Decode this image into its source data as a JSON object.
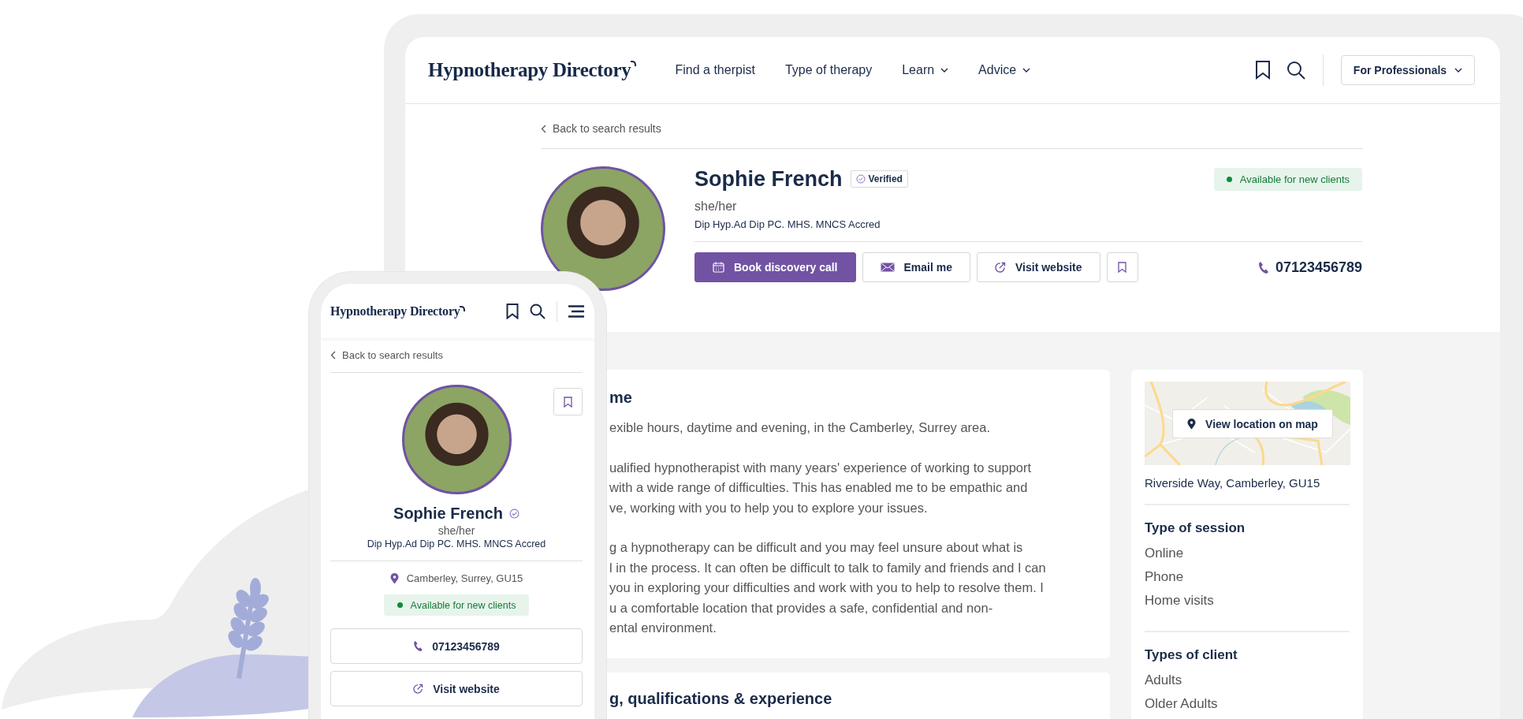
{
  "tablet": {
    "header": {
      "logo": "Hypnotherapy Directory",
      "nav": [
        {
          "label": "Find a therpist",
          "dropdown": false
        },
        {
          "label": "Type of therapy",
          "dropdown": false
        },
        {
          "label": "Learn",
          "dropdown": true
        },
        {
          "label": "Advice",
          "dropdown": true
        }
      ],
      "professionals_button": "For Professionals"
    },
    "back_link": "Back to search results",
    "profile": {
      "name": "Sophie French",
      "verified": true,
      "verified_label": "Verified",
      "pronouns": "she/her",
      "qualifications": "Dip Hyp.Ad Dip PC. MHS. MNCS Accred",
      "available": true,
      "availability": "Available for new clients",
      "actions": [
        {
          "kind": "primary",
          "label": "Book discovery call"
        },
        {
          "kind": "email",
          "label": "Email me"
        },
        {
          "kind": "website",
          "label": "Visit website"
        },
        {
          "kind": "save"
        }
      ],
      "phone": "07123456789"
    },
    "about": {
      "title": "me",
      "paragraphs": [
        [
          "exible hours, daytime and evening, in the Camberley, Surrey area."
        ],
        [
          "ualified hypnotherapist with many years' experience of working to support",
          "with a wide range of difficulties. This has enabled me to be empathic and",
          "ve, working with you to help you to explore your issues."
        ],
        [
          "g a hypnotherapy can be difficult and you may feel unsure about what is",
          "l in the process. It can often be difficult to talk to family and friends and I can",
          "you in exploring your difficulties and work with you to help to resolve them. I",
          "u a comfortable location that provides a safe, confidential and non-",
          "ental environment."
        ]
      ]
    },
    "training_title": "g, qualifications & experience",
    "sidebar": {
      "map_button": "View location on map",
      "address": "Riverside Way, Camberley, GU15",
      "sections": [
        {
          "title": "Type of session",
          "items": [
            "Online",
            "Phone",
            "Home visits"
          ]
        },
        {
          "title": "Types of client",
          "items": [
            "Adults",
            "Older Adults"
          ]
        }
      ]
    }
  },
  "phone": {
    "logo": "Hypnotherapy Directory",
    "back_link": "Back to search results",
    "name": "Sophie French",
    "verified": true,
    "pronouns": "she/her",
    "qualifications": "Dip Hyp.Ad Dip PC. MHS. MNCS Accred",
    "location": "Camberley, Surrey, GU15",
    "available": true,
    "availability": "Available for new clients",
    "phone": "07123456789",
    "website": "Visit website"
  }
}
